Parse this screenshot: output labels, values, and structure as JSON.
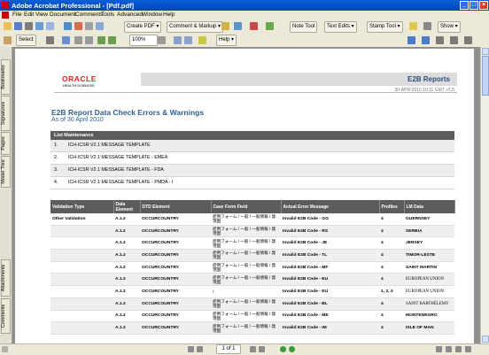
{
  "window": {
    "title": "Adobe Acrobat Professional - [Pdf.pdf]"
  },
  "menu": [
    "File",
    "Edit",
    "View",
    "Document",
    "Comments",
    "Tools",
    "Advanced",
    "Window",
    "Help"
  ],
  "toolbar1": {
    "create_pdf": "Create PDF",
    "comment_markup": "Comment & Markup",
    "note_tool": "Note Tool",
    "text_edits": "Text Edits",
    "stamp_tool": "Stamp Tool",
    "show": "Show"
  },
  "toolbar2": {
    "select": "Select",
    "zoom": "100%",
    "help": "Help"
  },
  "sidebar_tabs": [
    "Bookmarks",
    "Signatures",
    "Pages",
    "Model Tree",
    "Attachments",
    "Comments"
  ],
  "status": {
    "page_indicator": "1 of 1"
  },
  "report": {
    "logo_text": "ORACLE",
    "logo_sub": "HEALTH SCIENCES",
    "header_title": "E2B Reports",
    "header_date": "30-APR-2010 10:11 GMT +5.5",
    "title": "E2B Report Data Check Errors & Warnings",
    "subtitle": "As of 30 April 2010",
    "list_maintenance": {
      "header": "List Maintenance",
      "items": [
        {
          "n": "1.",
          "text": "ICH-ICSR V2.1 MESSAGE TEMPLATE"
        },
        {
          "n": "2.",
          "text": "ICH-ICSR V2.1 MESSAGE TEMPLATE - EMEA"
        },
        {
          "n": "3.",
          "text": "ICH-ICSR V2.1 MESSAGE TEMPLATE - FDA"
        },
        {
          "n": "4.",
          "text": "ICH-ICSR V2.1 MESSAGE TEMPLATE - PMDA - I"
        }
      ]
    },
    "errors": {
      "columns": [
        "Validation Type",
        "Data Element",
        "DTD Element",
        "Case Form Field",
        "Actual Error Message",
        "Profiles",
        "LM Data"
      ],
      "rows": [
        [
          "Other Validation",
          "A.1.2",
          "OCCURCOUNTRY",
          "症例フォーム / 一般 / 一般情報 / 発現国",
          "Invalid E2B Code - GG",
          "4",
          "GUERNSEY"
        ],
        [
          "",
          "A.1.2",
          "OCCURCOUNTRY",
          "症例フォーム / 一般 / 一般情報 / 発現国",
          "Invalid E2B Code - RS",
          "4",
          "SERBIA"
        ],
        [
          "",
          "A.1.2",
          "OCCURCOUNTRY",
          "症例フォーム / 一般 / 一般情報 / 発現国",
          "Invalid E2B Code - JE",
          "4",
          "JERSEY"
        ],
        [
          "",
          "A.1.2",
          "OCCURCOUNTRY",
          "症例フォーム / 一般 / 一般情報 / 発現国",
          "Invalid E2B Code - TL",
          "4",
          "TIMOR-LESTE"
        ],
        [
          "",
          "A.1.2",
          "OCCURCOUNTRY",
          "症例フォーム / 一般 / 一般情報 / 発現国",
          "Invalid E2B Code - MF",
          "4",
          "SAINT MARTIN"
        ],
        [
          "",
          "A.1.2",
          "OCCURCOUNTRY",
          "症例フォーム / 一般 / 一般情報 / 発現国",
          "Invalid E2B Code - EU",
          "4",
          "EUROPEAN UNION"
        ],
        [
          "",
          "A.1.2",
          "OCCURCOUNTRY",
          "/",
          "Invalid E2B Code - EU",
          "1, 2, 3",
          "EUROPEAN UNION"
        ],
        [
          "",
          "A.1.2",
          "OCCURCOUNTRY",
          "症例フォーム / 一般 / 一般情報 / 発現国",
          "Invalid E2B Code - BL",
          "4",
          "SAINT BARTHÉLEMY"
        ],
        [
          "",
          "A.1.2",
          "OCCURCOUNTRY",
          "症例フォーム / 一般 / 一般情報 / 発現国",
          "Invalid E2B Code - ME",
          "4",
          "MONTENEGRO"
        ],
        [
          "",
          "A.1.2",
          "OCCURCOUNTRY",
          "症例フォーム / 一般 / 一般情報 / 発現国",
          "Invalid E2B Code - IM",
          "4",
          "ISLE OF MAN"
        ]
      ]
    }
  }
}
